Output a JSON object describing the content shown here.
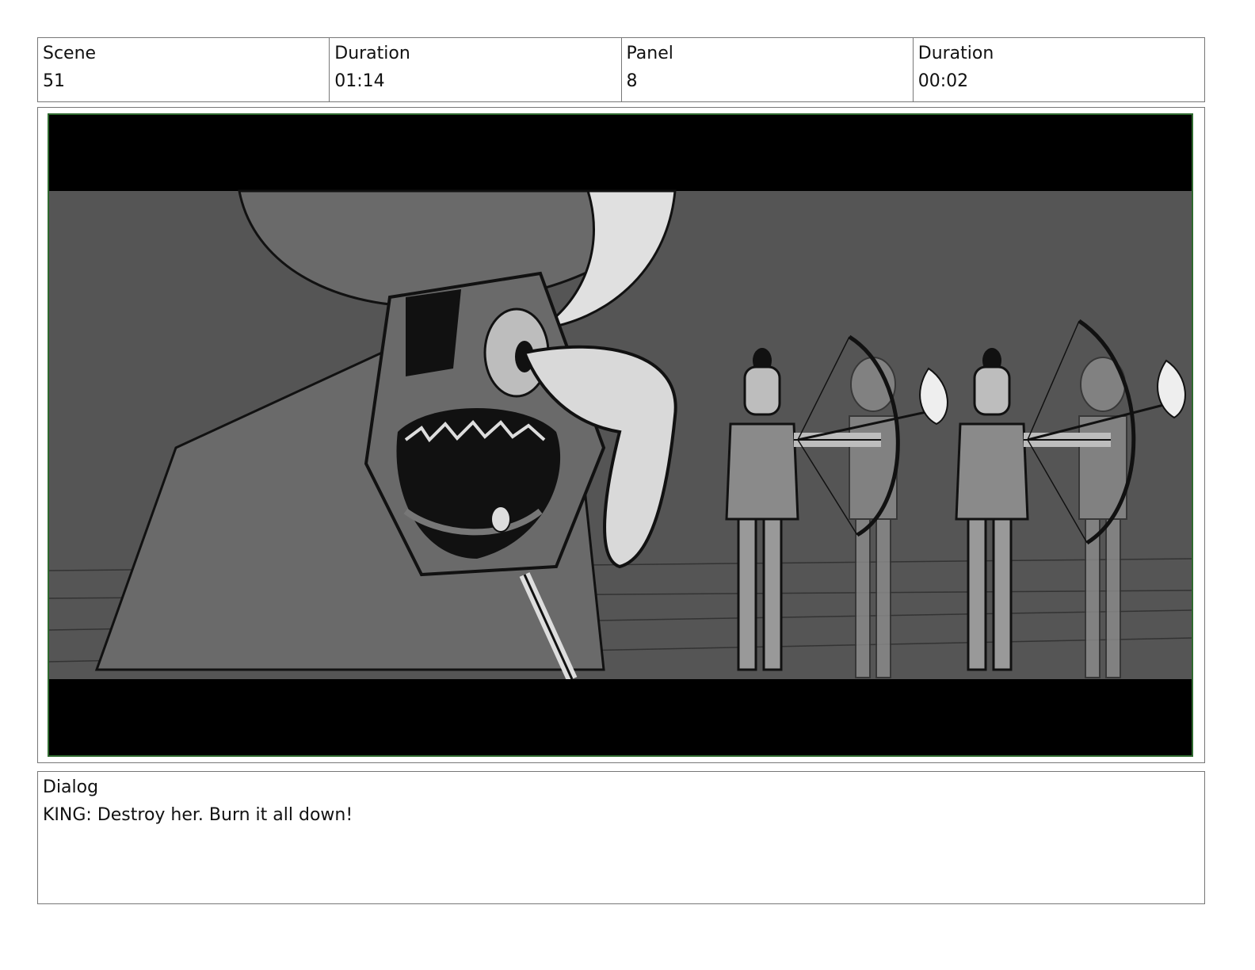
{
  "header": {
    "scene_label": "Scene",
    "scene_value": "51",
    "scene_duration_label": "Duration",
    "scene_duration_value": "01:14",
    "panel_label": "Panel",
    "panel_value": "8",
    "panel_duration_label": "Duration",
    "panel_duration_value": "00:02"
  },
  "dialog": {
    "label": "Dialog",
    "text": "KING: Destroy her. Burn it all down!"
  },
  "colors": {
    "frame_border": "#2f6a2f",
    "letterbox": "#000000",
    "backdrop": "#555555"
  }
}
